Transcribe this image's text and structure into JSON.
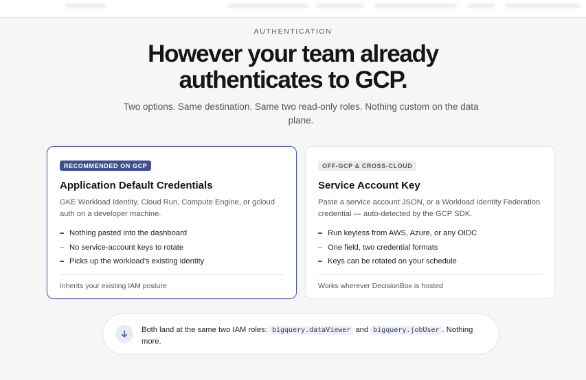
{
  "section": {
    "eyebrow": "AUTHENTICATION",
    "title_line1": "However your team already",
    "title_line2": "authenticates to GCP.",
    "subtitle": "Two options. Same destination. Same two read-only roles. Nothing custom on the data plane."
  },
  "cards": [
    {
      "badge": "RECOMMENDED ON GCP",
      "title": "Application Default Credentials",
      "description": "GKE Workload Identity, Cloud Run, Compute Engine, or gcloud auth on a developer machine.",
      "bullets": [
        "Nothing pasted into the dashboard",
        "No service-account keys to rotate",
        "Picks up the workload's existing identity"
      ],
      "footer": "Inherits your existing IAM posture"
    },
    {
      "badge": "OFF-GCP & CROSS-CLOUD",
      "title": "Service Account Key",
      "description": "Paste a service account JSON, or a Workload Identity Federation credential — auto-detected by the GCP SDK.",
      "bullets": [
        "Run keyless from AWS, Azure, or any OIDC",
        "One field, two credential formats",
        "Keys can be rotated on your schedule"
      ],
      "footer": "Works wherever DecisionBox is hosted"
    }
  ],
  "note": {
    "text_before": "Both land at the same two IAM roles:",
    "role1": "bigquery.dataViewer",
    "text_and": "and",
    "role2": "bigquery.jobUser",
    "text_after": ". Nothing more.",
    "icon": "arrow-down-icon"
  },
  "colors": {
    "accent": "#3f4f8f",
    "background": "#f6f6f4"
  }
}
